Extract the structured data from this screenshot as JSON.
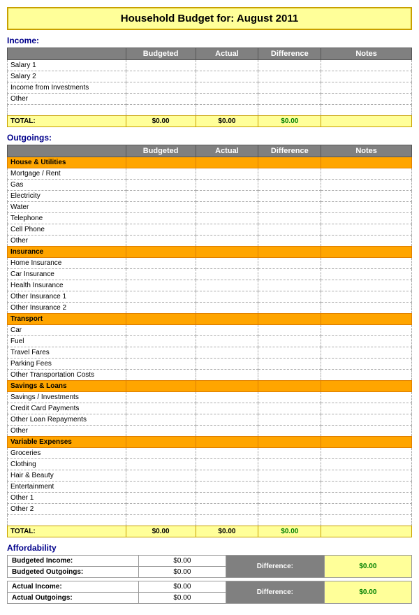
{
  "title": {
    "label": "Household Budget for:",
    "month": "August 2011",
    "full": "Household Budget for:   August 2011"
  },
  "income": {
    "section_title": "Income:",
    "columns": [
      "",
      "Budgeted",
      "Actual",
      "Difference",
      "Notes"
    ],
    "rows": [
      {
        "label": "Salary 1",
        "budgeted": "",
        "actual": "",
        "difference": "",
        "notes": ""
      },
      {
        "label": "Salary 2",
        "budgeted": "",
        "actual": "",
        "difference": "",
        "notes": ""
      },
      {
        "label": "Income from Investments",
        "budgeted": "",
        "actual": "",
        "difference": "",
        "notes": ""
      },
      {
        "label": "Other",
        "budgeted": "",
        "actual": "",
        "difference": "",
        "notes": ""
      }
    ],
    "total": {
      "label": "TOTAL:",
      "budgeted": "$0.00",
      "actual": "$0.00",
      "difference": "$0.00",
      "notes": ""
    }
  },
  "outgoings": {
    "section_title": "Outgoings:",
    "columns": [
      "",
      "Budgeted",
      "Actual",
      "Difference",
      "Notes"
    ],
    "groups": [
      {
        "header": "House & Utilities",
        "rows": [
          "Mortgage / Rent",
          "Gas",
          "Electricity",
          "Water",
          "Telephone",
          "Cell Phone",
          "Other"
        ]
      },
      {
        "header": "Insurance",
        "rows": [
          "Home Insurance",
          "Car Insurance",
          "Health Insurance",
          "Other Insurance 1",
          "Other Insurance 2"
        ]
      },
      {
        "header": "Transport",
        "rows": [
          "Car",
          "Fuel",
          "Travel Fares",
          "Parking Fees",
          "Other Transportation Costs"
        ]
      },
      {
        "header": "Savings & Loans",
        "rows": [
          "Savings / Investments",
          "Credit Card Payments",
          "Other Loan Repayments",
          "Other"
        ]
      },
      {
        "header": "Variable Expenses",
        "rows": [
          "Groceries",
          "Clothing",
          "Hair & Beauty",
          "Entertainment",
          "Other 1",
          "Other 2"
        ]
      }
    ],
    "total": {
      "label": "TOTAL:",
      "budgeted": "$0.00",
      "actual": "$0.00",
      "difference": "$0.00",
      "notes": ""
    }
  },
  "affordability": {
    "section_title": "Affordability",
    "budgeted_income_label": "Budgeted Income:",
    "budgeted_income_value": "$0.00",
    "budgeted_outgoings_label": "Budgeted Outgoings:",
    "budgeted_outgoings_value": "$0.00",
    "budgeted_difference_label": "Difference:",
    "budgeted_difference_value": "$0.00",
    "actual_income_label": "Actual Income:",
    "actual_income_value": "$0.00",
    "actual_outgoings_label": "Actual Outgoings:",
    "actual_outgoings_value": "$0.00",
    "actual_difference_label": "Difference:",
    "actual_difference_value": "$0.00"
  }
}
